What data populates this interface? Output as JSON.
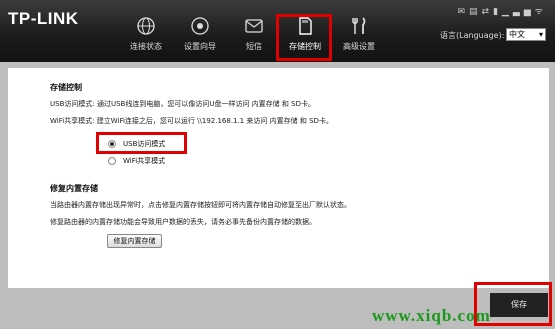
{
  "header": {
    "logo": "TP-LINK",
    "nav": [
      {
        "label": "连接状态",
        "icon": "globe-icon"
      },
      {
        "label": "设置向导",
        "icon": "wizard-icon"
      },
      {
        "label": "短信",
        "icon": "sms-icon"
      },
      {
        "label": "存储控制",
        "icon": "sd-card-icon"
      },
      {
        "label": "高级设置",
        "icon": "tools-icon"
      }
    ],
    "language_label": "语言(Language):",
    "language_value": "中文"
  },
  "storage": {
    "title": "存储控制",
    "usb_desc": "USB访问模式: 通过USB线连到电脑，您可以像访问U盘一样访问 内置存储 和 SD卡。",
    "wifi_desc": "WiFi共享模式: 建立WiFi连接之后，您可以运行 \\\\192.168.1.1 来访问 内置存储 和 SD卡。",
    "options": [
      "USB访问模式",
      "WiFi共享模式"
    ],
    "selected": "USB访问模式"
  },
  "restore": {
    "title": "修复内置存储",
    "desc1": "当路由器内置存储出现异常时，点击修复内置存储按钮即可将内置存储自动修复至出厂默认状态。",
    "desc2": "修复路由器的内置存储功能会导致用户数据的丢失，请务必事先备份内置存储的数据。",
    "button": "修复内置存储"
  },
  "footer": {
    "save": "保存"
  },
  "watermark": "www.xiqb.com",
  "colors": {
    "highlight": "#e00000",
    "watermark": "#1a9a1a",
    "topbar": "#1b1b1b"
  }
}
